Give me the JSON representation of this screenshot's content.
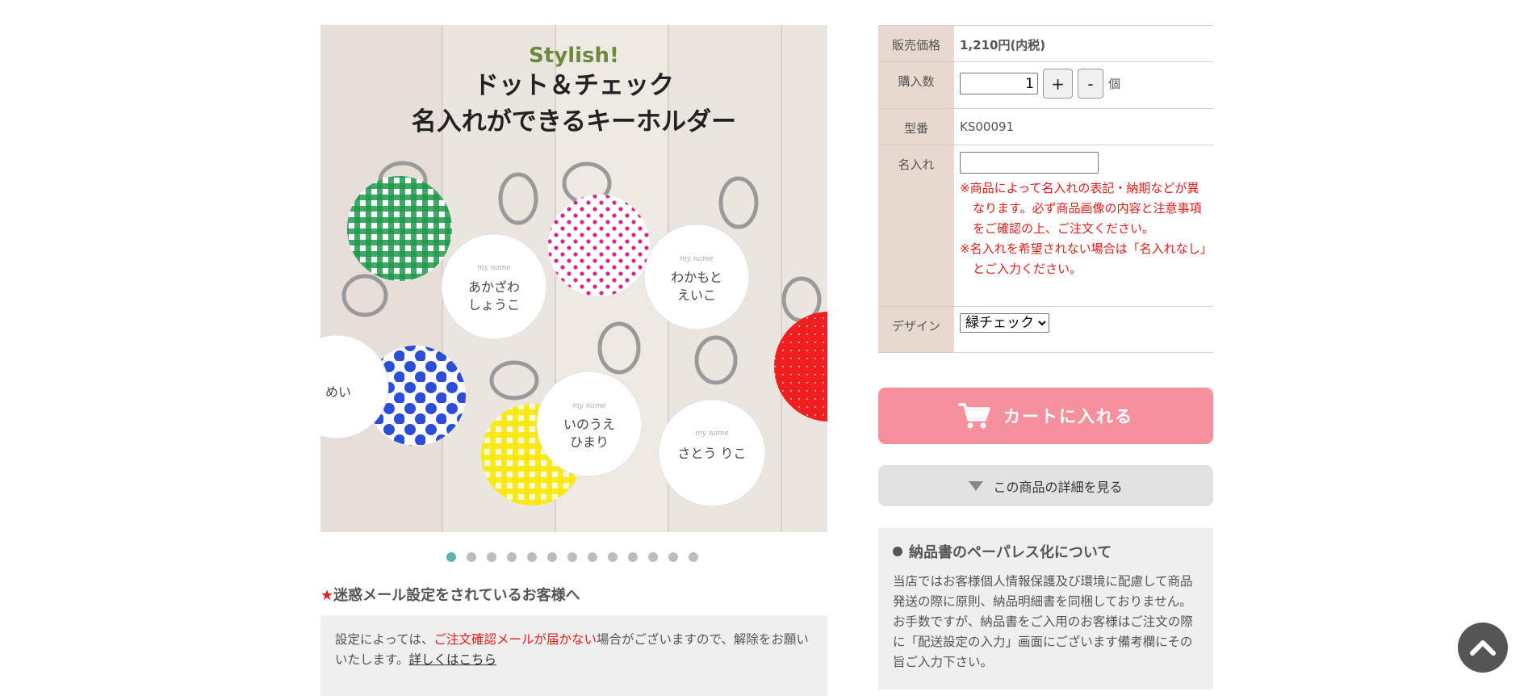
{
  "gallery": {
    "image_headline_en": "Stylish!",
    "image_headline_jp_1": "ドット＆チェック",
    "image_headline_jp_2": "名入れができるキーホルダー",
    "tags": [
      {
        "line1": "あかざわ",
        "line2": "しょうこ"
      },
      {
        "line1": "わかもと",
        "line2": "えいこ"
      },
      {
        "line1": "めい",
        "line2": ""
      },
      {
        "line1": "いのうえ",
        "line2": "ひまり"
      },
      {
        "line1": "さとう りこ",
        "line2": ""
      }
    ],
    "tag_script": "my name",
    "slide_count": 13,
    "active_slide": 1,
    "colors": {
      "green": "#1f9a4b",
      "pink": "#d2288a",
      "blue": "#2a4fd6",
      "yellow": "#f7e800",
      "red": "#f01e1e"
    }
  },
  "notice": {
    "star": "★",
    "heading": "迷惑メール設定をされているお客様へ",
    "text_before": "設定によっては、",
    "text_red": "ご注文確認メールが届かない",
    "text_after": "場合がございますので、解除をお願いいたします。",
    "link": "詳しくはこちら"
  },
  "spec": {
    "price_label": "販売価格",
    "price_value": "1,210円(内税)",
    "qty_label": "購入数",
    "qty_value": "1",
    "qty_plus": "+",
    "qty_minus": "-",
    "qty_unit": "個",
    "model_label": "型番",
    "model_value": "KS00091",
    "name_label": "名入れ",
    "name_value": "",
    "warn_1": "※商品によって名入れの表記・納期などが異なります。必ず商品画像の内容と注意事項をご確認の上、ご注文ください。",
    "warn_2": "※名入れを希望されない場合は「名入れなし」とご入力ください。",
    "design_label": "デザイン",
    "design_selected": "緑チェック"
  },
  "buttons": {
    "cart": "カートに入れる",
    "detail": "この商品の詳細を見る",
    "cart_color": "#f5909c"
  },
  "paperless": {
    "title": "納品書のペーパレス化について",
    "body": "当店ではお客様個人情報保護及び環境に配慮して商品発送の際に原則、納品明細書を同梱しておりません。 お手数ですが、納品書をご入用のお客様はご注文の際に「配送設定の入力」画面にございます備考欄にその旨ご入力下さい。"
  },
  "icons": {
    "cart": "cart-icon",
    "to_top": "chevron-up-icon",
    "detail": "triangle-down-icon"
  }
}
